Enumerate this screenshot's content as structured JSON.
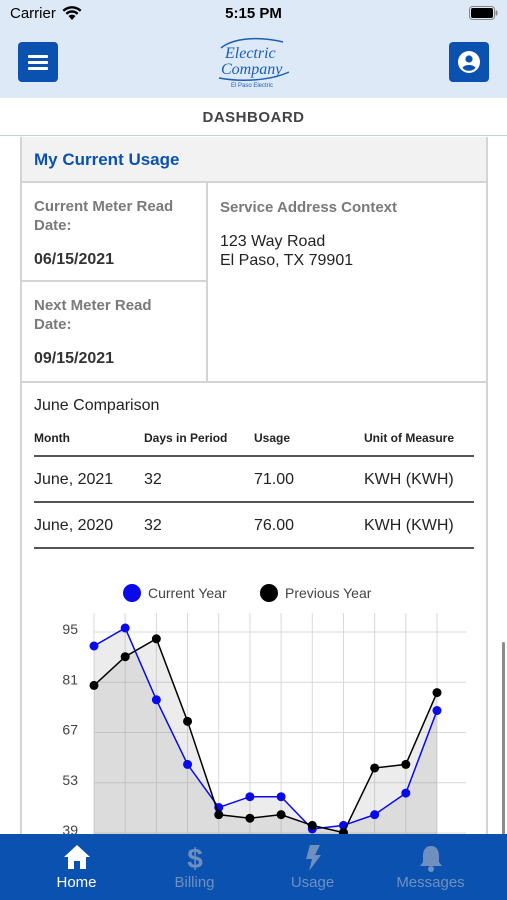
{
  "status_bar": {
    "carrier": "Carrier",
    "time": "5:15 PM"
  },
  "header": {
    "logo_text": "Electric Company",
    "logo_subtext": "El Paso Electric"
  },
  "subheader": {
    "title": "DASHBOARD"
  },
  "usage_card": {
    "title": "My Current Usage",
    "current_meter": {
      "label_line1": "Current Meter Read",
      "label_line2": "Date:",
      "value": "06/15/2021"
    },
    "next_meter": {
      "label_line1": "Next Meter Read",
      "label_line2": "Date:",
      "value": "09/15/2021"
    },
    "service_address": {
      "label": "Service Address Context",
      "line1": "123 Way Road",
      "line2": "El Paso, TX 79901"
    }
  },
  "comparison": {
    "title": "June Comparison",
    "columns": [
      "Month",
      "Days in Period",
      "Usage",
      "Unit of Measure"
    ],
    "rows": [
      [
        "June, 2021",
        "32",
        "71.00",
        "KWH (KWH)"
      ],
      [
        "June, 2020",
        "32",
        "76.00",
        "KWH (KWH)"
      ]
    ]
  },
  "chart_data": {
    "type": "line",
    "legend_position": "top",
    "grid": true,
    "y_ticks": [
      95,
      81,
      67,
      53,
      39
    ],
    "ylim": [
      39,
      99
    ],
    "series": [
      {
        "name": "Current Year",
        "color": "#0a0ae8",
        "values": [
          90,
          95,
          75,
          57,
          45,
          48,
          48,
          39,
          40,
          43,
          49,
          72
        ]
      },
      {
        "name": "Previous Year",
        "color": "#000000",
        "values": [
          79,
          87,
          92,
          69,
          43,
          42,
          43,
          40,
          38,
          56,
          57,
          77
        ]
      }
    ]
  },
  "tabs": [
    {
      "label": "Home",
      "icon": "home-icon",
      "active": true
    },
    {
      "label": "Billing",
      "icon": "dollar-icon",
      "active": false
    },
    {
      "label": "Usage",
      "icon": "bolt-icon",
      "active": false
    },
    {
      "label": "Messages",
      "icon": "bell-icon",
      "active": false
    }
  ],
  "colors": {
    "brand_blue": "#0b52b0",
    "header_bg": "#dde9f7"
  }
}
